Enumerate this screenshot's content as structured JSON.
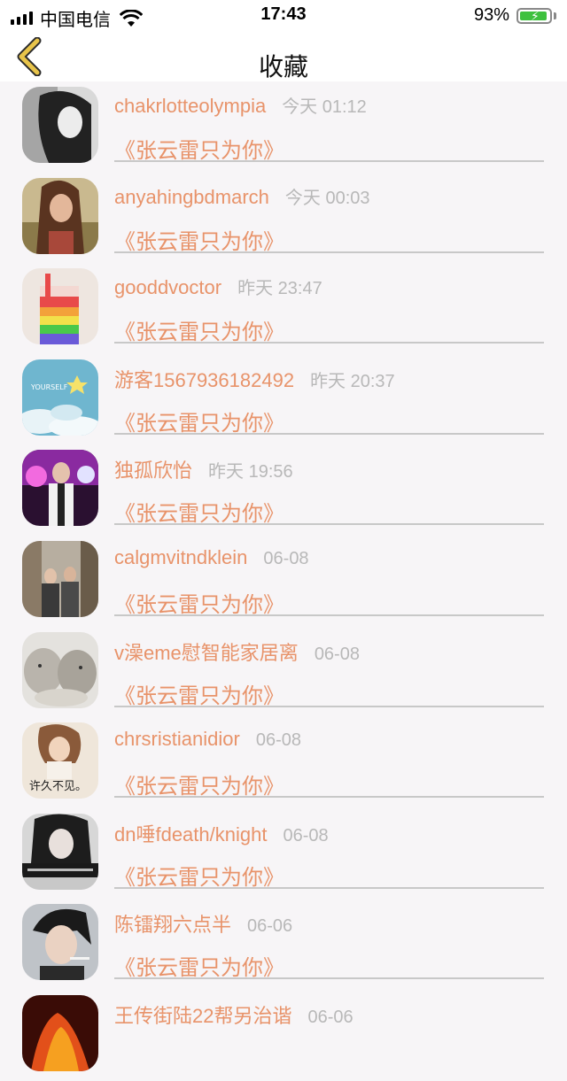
{
  "status_bar": {
    "carrier": "中国电信",
    "time": "17:43",
    "battery": "93%"
  },
  "nav": {
    "title": "收藏",
    "back_icon": "chevron-left-icon"
  },
  "colors": {
    "accent": "#e8936a",
    "muted": "#b8b8b8",
    "back": "#e8c44a"
  },
  "items": [
    {
      "user": "chakrlotteolympia",
      "time": "今天 01:12",
      "song": "《张云雷只为你》",
      "avatar": "avatar-bw-portrait"
    },
    {
      "user": "anyahingbdmarch",
      "time": "今天 00:03",
      "song": "《张云雷只为你》",
      "avatar": "avatar-woman-long-hair"
    },
    {
      "user": "gooddvoctor",
      "time": "昨天 23:47",
      "song": "《张云雷只为你》",
      "avatar": "avatar-rainbow-drink"
    },
    {
      "user": "游客1567936182492",
      "time": "昨天 20:37",
      "song": "《张云雷只为你》",
      "avatar": "avatar-blue-sky"
    },
    {
      "user": "独孤欣怡",
      "time": "昨天 19:56",
      "song": "《张云雷只为你》",
      "avatar": "avatar-stage-man"
    },
    {
      "user": "calgmvitndklein",
      "time": "06-08",
      "song": "《张云雷只为你》",
      "avatar": "avatar-street-couple"
    },
    {
      "user": "v澡eme慰智能家居离",
      "time": "06-08",
      "song": "《张云雷只为你》",
      "avatar": "avatar-rabbits"
    },
    {
      "user": "chrsristianidior",
      "time": "06-08",
      "song": "《张云雷只为你》",
      "avatar": "avatar-text-image",
      "avatar_text": "许久不见。"
    },
    {
      "user": "dn唾fdeath/knight",
      "time": "06-08",
      "song": "《张云雷只为你》",
      "avatar": "avatar-dark-girl"
    },
    {
      "user": "陈镭翔六点半",
      "time": "06-06",
      "song": "《张云雷只为你》",
      "avatar": "avatar-young-man"
    },
    {
      "user": "王传街陆22帮另治谐",
      "time": "06-06",
      "song": "",
      "avatar": "avatar-fire"
    }
  ]
}
